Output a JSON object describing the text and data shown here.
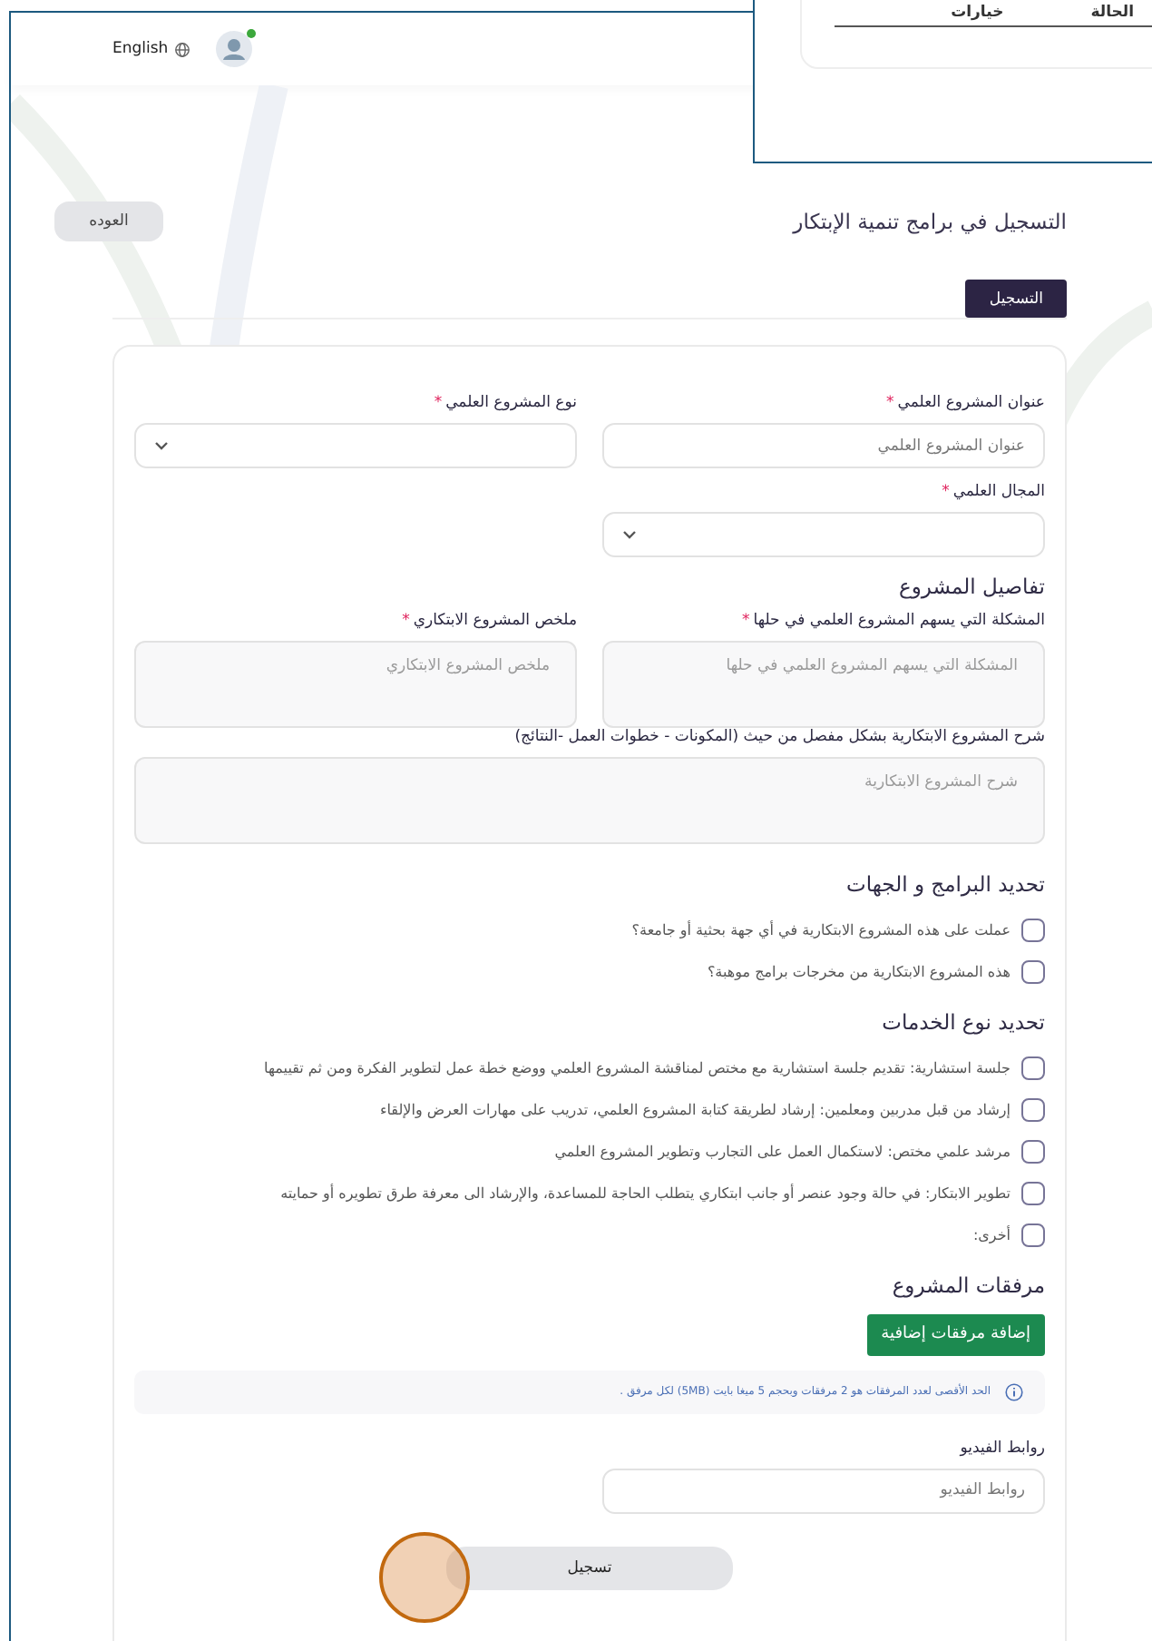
{
  "header": {
    "language": "English",
    "user_online": true
  },
  "overlay_window": {
    "table_columns": [
      "الحالة",
      "خيارات"
    ]
  },
  "page": {
    "title": "التسجيل في برامج تنمية الإبتكار",
    "back_button": "العوده"
  },
  "tabs": [
    {
      "label": "التسجيل",
      "selected": true
    }
  ],
  "form": {
    "fields": [
      {
        "kind": "input",
        "label": "عنوان المشروع العلمي",
        "required_mark": "*",
        "placeholder": "عنوان المشروع العلمي"
      },
      {
        "kind": "select",
        "label": "نوع المشروع العلمي",
        "required_mark": "*"
      },
      {
        "kind": "select",
        "label": "المجال العلمي",
        "required_mark": "*"
      }
    ],
    "details_heading": "تفاصيل المشروع",
    "details_fields": [
      {
        "kind": "textarea",
        "label": "المشكلة التي يسهم المشروع العلمي في حلها",
        "required_mark": "*",
        "placeholder": "المشكلة التي يسهم المشروع العلمي في حلها"
      },
      {
        "kind": "textarea",
        "label": "ملخص المشروع الابتكاري",
        "required_mark": "*",
        "placeholder": "ملخص المشروع الابتكاري"
      }
    ],
    "description": {
      "label": "شرح المشروع الابتكارية بشكل مفصل من حيث (المكونات - خطوات العمل -النتائج)",
      "placeholder": "شرح المشروع الابتكارية"
    },
    "programs_heading": "تحديد البرامج و الجهات",
    "programs": [
      {
        "label": "عملت على هذه المشروع الابتكارية في أي جهة بحثية أو جامعة؟",
        "checked": false
      },
      {
        "label": "هذه المشروع الابتكارية من مخرجات برامج موهبة؟",
        "checked": false
      }
    ],
    "services_heading": "تحديد نوع الخدمات",
    "services": [
      {
        "label": "جلسة استشارية: تقديم جلسة استشارية مع مختص لمناقشة المشروع العلمي ووضع خطة عمل لتطوير الفكرة ومن ثم تقييمها",
        "checked": false
      },
      {
        "label": "إرشاد من قبل مدربين ومعلمين: إرشاد لطريقة كتابة المشروع العلمي، تدريب على مهارات العرض والإلقاء",
        "checked": false
      },
      {
        "label": "مرشد علمي مختص: لاستكمال العمل على التجارب وتطوير المشروع العلمي",
        "checked": false
      },
      {
        "label": "تطوير الابتكار: في حالة وجود عنصر أو جانب ابتكاري يتطلب الحاجة للمساعدة، والإرشاد الى معرفة طرق تطويره أو حمايته",
        "checked": false
      },
      {
        "label": "أخرى:",
        "checked": false
      }
    ],
    "attachments_heading": "مرفقات المشروع",
    "add_attachments_button": "إضافة مرفقات إضافية",
    "attachments_note": "الحد الأقصى لعدد المرفقات هو 2 مرفقات وبحجم 5 ميغا بايت (5MB) لكل مرفق .",
    "video": {
      "label": "روابط الفيديو",
      "placeholder": "روابط الفيديو"
    },
    "submit_button": "تسجيل"
  },
  "click_indicator": true
}
